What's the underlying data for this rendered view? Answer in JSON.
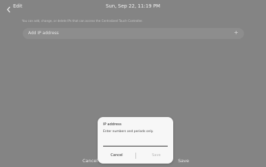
{
  "header": {
    "back_label": "Edit",
    "back_icon": "chevron-left-icon",
    "datetime": "Sun, Sep 22, 11:19 PM"
  },
  "main": {
    "info_text": "You can add, change, or delete IPs that can access the Centralized Touch Controller.",
    "add_row": {
      "label": "Add IP address",
      "icon": "plus-icon",
      "icon_glyph": "+"
    }
  },
  "footer": {
    "cancel_label": "Cancel",
    "save_label": "Save"
  },
  "dialog": {
    "title": "IP address",
    "hint": "Enter numbers and periods only.",
    "input_value": "",
    "cancel_label": "Cancel",
    "save_label": "Save",
    "save_color_disabled": "#b5b5b5"
  },
  "colors": {
    "background": "#848484",
    "dialog_bg": "#f7f7f7"
  }
}
